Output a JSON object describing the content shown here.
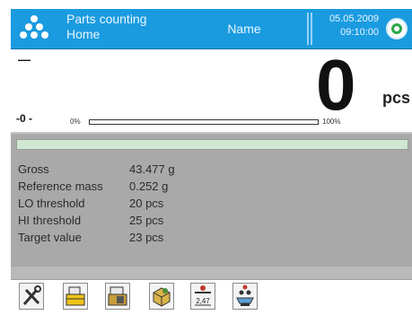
{
  "header": {
    "mode_line1": "Parts counting",
    "mode_line2": "Home",
    "name_label": "Name",
    "date": "05.05.2009",
    "time": "09:10:00",
    "colors": {
      "header_bg": "#1a9be0",
      "status_ok": "#2aa84a"
    }
  },
  "display": {
    "stability_marker": "—",
    "zero_indicator": "-0 -",
    "value": "0",
    "unit": "pcs",
    "bar_min_label": "0%",
    "bar_max_label": "100%",
    "bar_fill_percent": 0
  },
  "info": {
    "rows": [
      {
        "label": "Gross",
        "value": "43.477 g"
      },
      {
        "label": "Reference mass",
        "value": "0.252 g"
      },
      {
        "label": "LO threshold",
        "value": "20 pcs"
      },
      {
        "label": "HI threshold",
        "value": "25 pcs"
      },
      {
        "label": "Target value",
        "value": "23 pcs"
      }
    ]
  },
  "toolbar": {
    "buttons": [
      {
        "icon": "tools-icon",
        "value_text": ""
      },
      {
        "icon": "product-database-icon",
        "value_text": ""
      },
      {
        "icon": "packaging-database-icon",
        "value_text": ""
      },
      {
        "icon": "reference-sample-icon",
        "value_text": ""
      },
      {
        "icon": "reference-mass-icon",
        "value_text": "2,47"
      },
      {
        "icon": "counting-mode-icon",
        "value_text": ""
      }
    ]
  }
}
